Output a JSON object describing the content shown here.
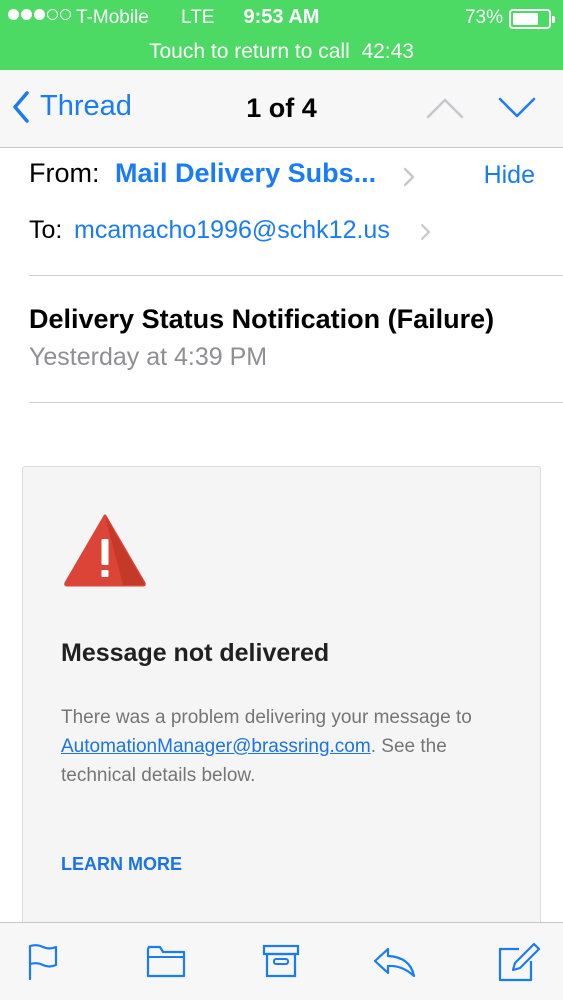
{
  "status_bar": {
    "carrier": "T-Mobile",
    "network": "LTE",
    "time": "9:53 AM",
    "battery": "73%",
    "battery_level": 0.73,
    "signal_bars": 3,
    "signal_max": 5
  },
  "call_banner": {
    "text": "Touch to return to call",
    "duration": "42:43"
  },
  "nav": {
    "back_label": "Thread",
    "position": "1 of 4",
    "up_icon": "chevron-up-icon",
    "down_icon": "chevron-down-icon"
  },
  "header": {
    "from_label": "From:",
    "from_value": "Mail Delivery Subs...",
    "hide_label": "Hide",
    "to_label": "To:",
    "to_value": "mcamacho1996@schk12.us",
    "subject": "Delivery Status Notification (Failure)",
    "date": "Yesterday at 4:39 PM"
  },
  "message": {
    "icon": "warning-triangle-icon",
    "title": "Message not delivered",
    "body_prefix": "There was a problem delivering your message to ",
    "link_email": "AutomationManager@brassring.com",
    "body_suffix": ". See the technical details below.",
    "learn_more": "LEARN MORE"
  },
  "toolbar": {
    "icons": [
      "flag-icon",
      "folder-icon",
      "archive-icon",
      "reply-icon",
      "compose-icon"
    ]
  },
  "colors": {
    "accent": "#1a7cf5",
    "call_green": "#4cd964",
    "warning_red": "#db4437",
    "link_blue": "#1a73e8"
  }
}
